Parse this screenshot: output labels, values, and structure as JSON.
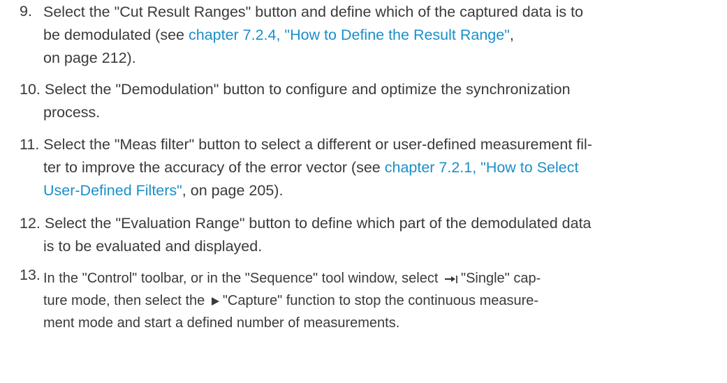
{
  "steps": [
    {
      "number": "9.",
      "lines": [
        [
          "Select the \"Cut Result Ranges\" button and define which of the captured data is to"
        ],
        [
          "be demodulated (see ",
          "chapter 7.2.4, \"How to Define the Result Range\"",
          ","
        ],
        [
          "on page 212)."
        ]
      ]
    },
    {
      "number": "10.",
      "lines": [
        [
          "Select the \"Demodulation\" button to configure and optimize the synchronization"
        ],
        [
          "process."
        ]
      ]
    },
    {
      "number": "11.",
      "lines": [
        [
          "Select the \"Meas filter\" button to select a different or user-defined measurement fil-"
        ],
        [
          "ter to improve the accuracy of the error vector (see ",
          "chapter 7.2.1, \"How to Select"
        ],
        [
          "User-Defined Filters\"",
          ", on page 205)."
        ]
      ]
    },
    {
      "number": "12.",
      "lines": [
        [
          "Select the \"Evaluation Range\" button to define which part of the demodulated data"
        ],
        [
          "is to be evaluated and displayed."
        ]
      ]
    },
    {
      "number": "13.",
      "lines": [
        [
          "In the \"Control\" toolbar, or in the \"Sequence\" tool window, select ",
          "\"Single\" cap-"
        ],
        [
          "ture mode, then select the ",
          "\"Capture\" function to stop the continuous measure-"
        ],
        [
          "ment mode and start a defined number of measurements."
        ]
      ]
    }
  ],
  "icons": {
    "single_capture": "single-capture-icon",
    "capture": "play-icon"
  },
  "colors": {
    "text": "#3a3a3a",
    "link": "#1a8fc9"
  }
}
